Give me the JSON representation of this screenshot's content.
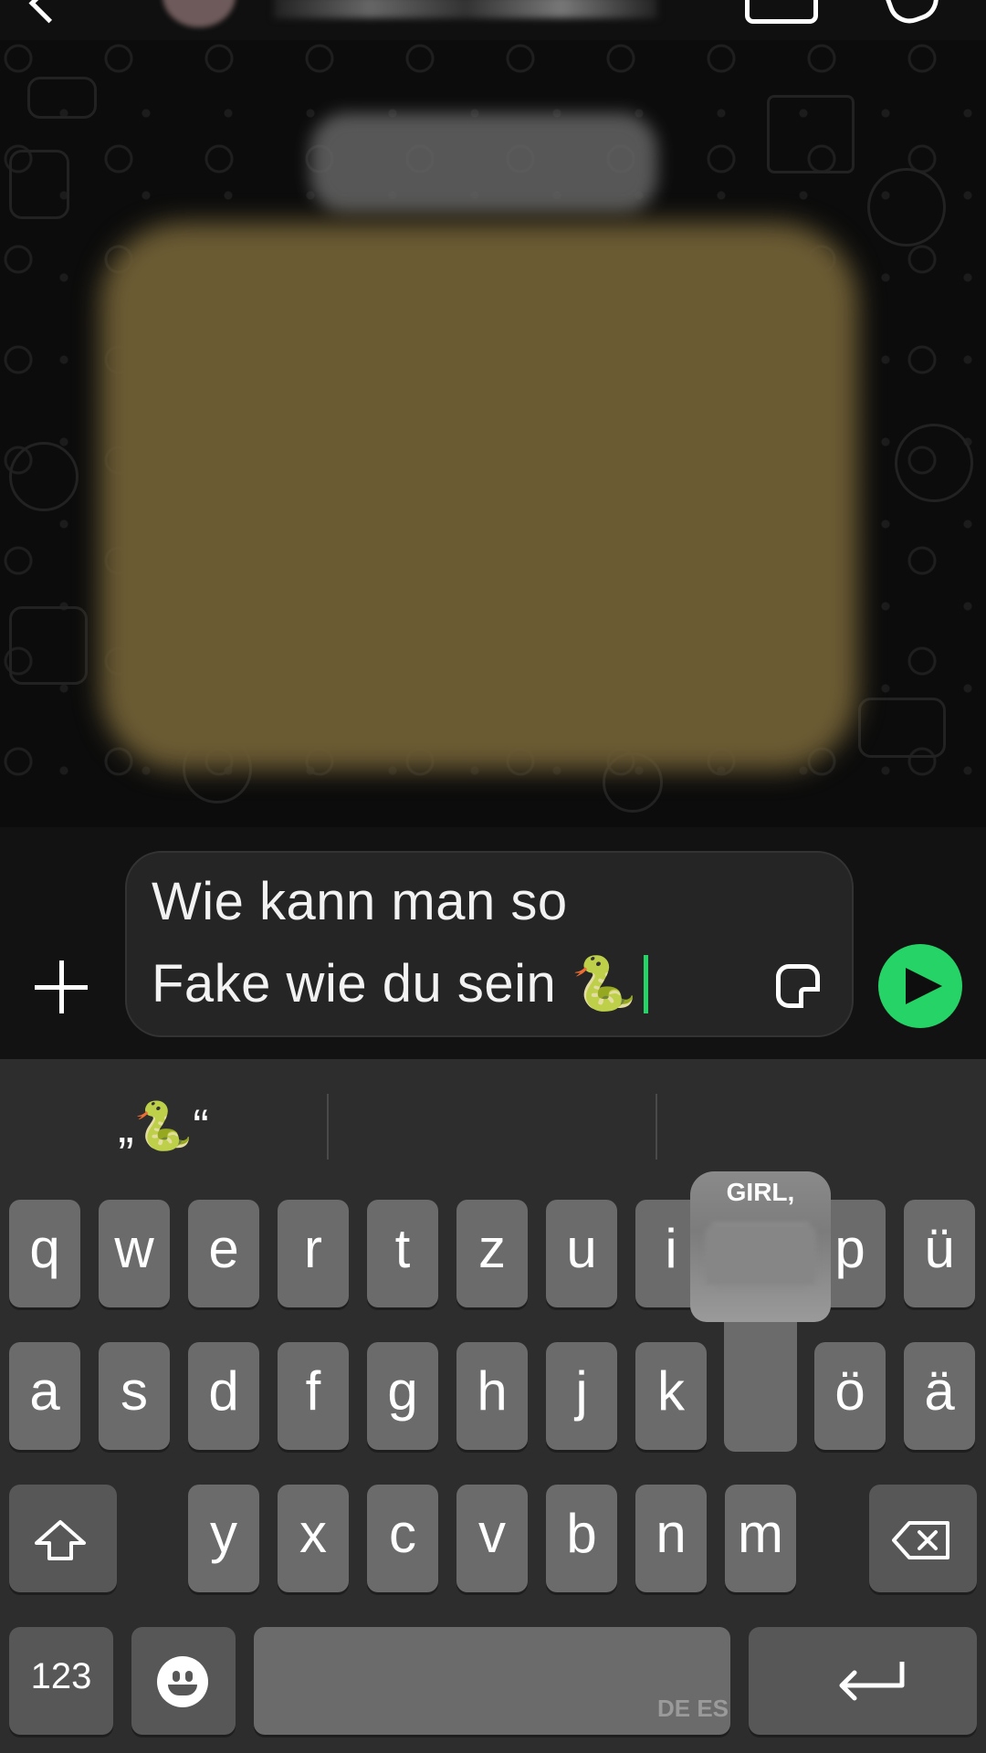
{
  "composer": {
    "message_line1": "Wie kann man so",
    "message_line2": "Fake wie du sein 🐍"
  },
  "keyboard": {
    "suggestions": [
      "„🐍“",
      "",
      ""
    ],
    "popup_label": "GIRL,",
    "row1": [
      "q",
      "w",
      "e",
      "r",
      "t",
      "z",
      "u",
      "i",
      "",
      "p",
      "ü"
    ],
    "row2": [
      "a",
      "s",
      "d",
      "f",
      "g",
      "h",
      "j",
      "k",
      "",
      "ö",
      "ä"
    ],
    "row3": [
      "y",
      "x",
      "c",
      "v",
      "b",
      "n",
      "m"
    ],
    "numbers_key": "123",
    "space_languages": "DE ES"
  },
  "icons": {
    "attach": "plus-icon",
    "sticker": "sticker-icon",
    "send": "send-icon",
    "shift": "shift-icon",
    "backspace": "backspace-icon",
    "emoji": "emoji-icon",
    "return": "return-icon"
  },
  "colors": {
    "accent": "#25d366",
    "keyboard_bg": "#2d2d2d",
    "key_bg": "#6b6b6b"
  }
}
